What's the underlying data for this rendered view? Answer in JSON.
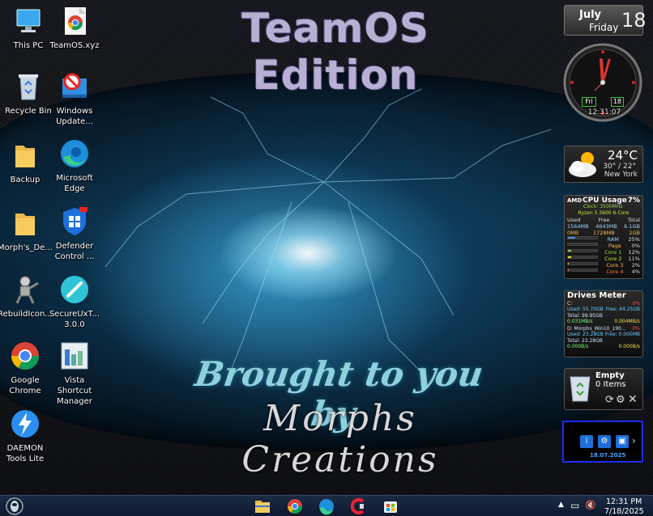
{
  "wallpaper": {
    "title": "TeamOS Edition",
    "line1": "Brought to you by",
    "line2": "Morphs Creations"
  },
  "desktop_icons": [
    {
      "label": "This PC",
      "icon": "this-pc-icon"
    },
    {
      "label": "TeamOS.xyz",
      "icon": "chrome-shortcut-icon"
    },
    {
      "label": "Recycle Bin",
      "icon": "recycle-bin-icon"
    },
    {
      "label": "Windows Update...",
      "icon": "windows-update-icon"
    },
    {
      "label": "Backup",
      "icon": "folder-icon"
    },
    {
      "label": "Microsoft Edge",
      "icon": "edge-icon"
    },
    {
      "label": "Morph's_De...",
      "icon": "folder-icon"
    },
    {
      "label": "Defender Control ...",
      "icon": "defender-icon"
    },
    {
      "label": "RebuildIcon...",
      "icon": "rebuild-icon"
    },
    {
      "label": "SecureUxT... 3.0.0",
      "icon": "secureux-icon"
    },
    {
      "label": "Google Chrome",
      "icon": "chrome-icon"
    },
    {
      "label": "Vista Shortcut Manager",
      "icon": "vista-shortcut-icon"
    },
    {
      "label": "DAEMON Tools Lite",
      "icon": "daemon-tools-icon"
    }
  ],
  "gadgets": {
    "date": {
      "month": "July",
      "weekday": "Friday",
      "day": "18"
    },
    "clock": {
      "day_label": "Fri",
      "date_label": "18",
      "time": "12:31:07"
    },
    "weather": {
      "temp": "24°C",
      "range": "30° / 22°",
      "city": "New York"
    },
    "cpu": {
      "brand": "AMD",
      "title": "CPU Usage",
      "usage": "7%",
      "clock": "Clock: 3500MHz",
      "model": "Ryzen 5 3600 6-Core",
      "mem_headers": [
        "Used",
        "Free",
        "Total"
      ],
      "mem_row1": [
        "1564MB",
        "4643MB",
        "6.1GB"
      ],
      "mem_row2": [
        "0MB",
        "1728MB",
        "2GB"
      ],
      "ram_label": "RAM",
      "ram_value": "25%",
      "ram_fraction": 0.25,
      "page_label": "Page",
      "page_value": "0%",
      "page_fraction": 0.0,
      "cores": [
        {
          "label": "Core 1",
          "value": "12%",
          "fraction": 0.12
        },
        {
          "label": "Core 2",
          "value": "11%",
          "fraction": 0.11
        },
        {
          "label": "Core 3",
          "value": "2%",
          "fraction": 0.02
        },
        {
          "label": "Core 4",
          "value": "4%",
          "fraction": 0.04
        }
      ]
    },
    "drives": {
      "title": "Drives Meter",
      "c_label": "C:",
      "c_pct": "0%",
      "c_used": "Used: 55.70GB",
      "c_free": "Free: 44.25GB",
      "c_total": "Total: 99.95GB",
      "c_up": "0.031MB/s",
      "c_down": "0.004MB/s",
      "d_label": "D: Morphs_Win10_190...",
      "d_pct": "0%",
      "d_used": "Used: 23.28GB",
      "d_free": "Free: 0.000MB",
      "d_total": "Total: 23.28GB",
      "d_up": "0.000B/s",
      "d_down": "0.000B/s"
    },
    "recycle": {
      "title": "Empty",
      "items": "0 Items"
    },
    "switch": {
      "date": "18.07.2025"
    }
  },
  "taskbar": {
    "time": "12:31 PM",
    "date": "7/18/2025"
  },
  "colors": {
    "taskbar": "#1b2a43",
    "accent_blue": "#1d2cff",
    "title_lavender": "#b7b0d3",
    "cyan_text": "#8fd0dd"
  }
}
